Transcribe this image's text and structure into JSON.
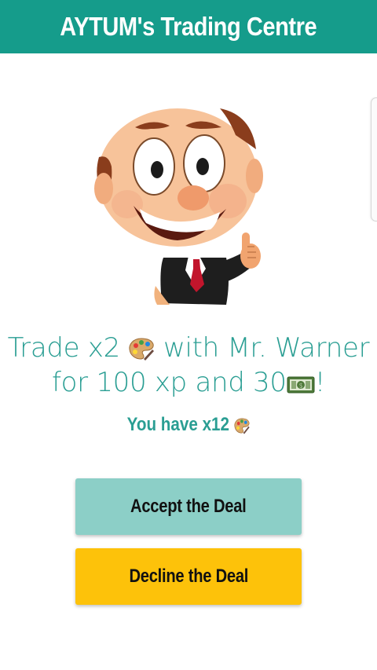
{
  "header": {
    "title": "AYTUM's Trading Centre"
  },
  "offer": {
    "line1_prefix": "Trade x2",
    "line1_suffix": "with Mr. Warner",
    "line2_prefix": "for 100  xp and 30",
    "line2_suffix": "!",
    "item_icon": "palette-icon",
    "currency_icon": "money-icon"
  },
  "inventory": {
    "label": "You have x12"
  },
  "actions": {
    "accept_label": "Accept the Deal",
    "decline_label": "Decline the Deal"
  },
  "colors": {
    "header_bg": "#159c8b",
    "teal_text": "#2a9e93",
    "accept_bg": "#8ccfc7",
    "decline_bg": "#fdc20a"
  }
}
